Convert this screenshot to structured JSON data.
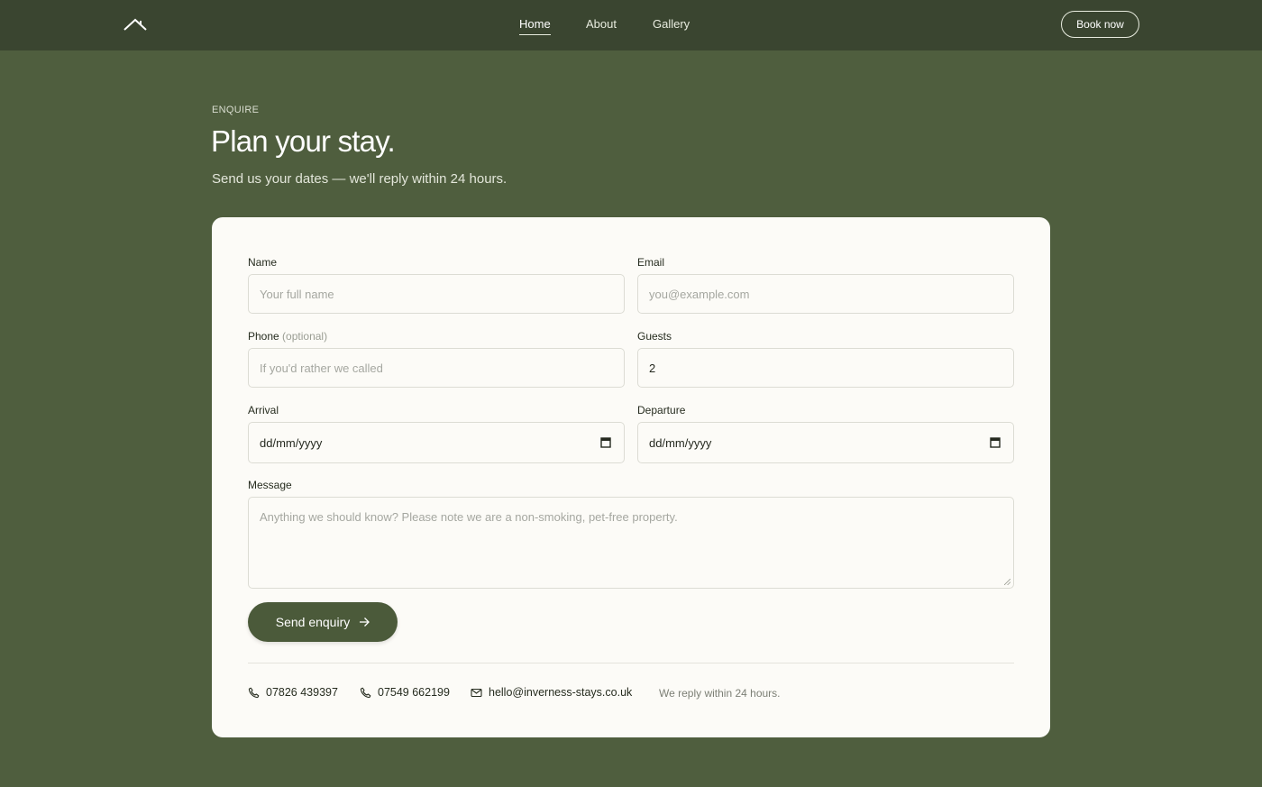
{
  "nav": {
    "logo_icon": "roof-house-icon",
    "links": [
      {
        "label": "Home",
        "active": true
      },
      {
        "label": "About",
        "active": false
      },
      {
        "label": "Gallery",
        "active": false
      }
    ],
    "cta": "Book now"
  },
  "hero": {
    "eyebrow": "ENQUIRE",
    "title": "Plan your stay.",
    "subtitle": "Send us your dates — we'll reply within 24 hours."
  },
  "form": {
    "name": {
      "label": "Name",
      "placeholder": "Your full name"
    },
    "email": {
      "label": "Email",
      "placeholder": "you@example.com"
    },
    "phone": {
      "label": "Phone",
      "optional": "(optional)",
      "placeholder": "If you'd rather we called"
    },
    "guests": {
      "label": "Guests",
      "value": "2"
    },
    "arrival": {
      "label": "Arrival",
      "value": "dd/mm/yyyy",
      "icon": "calendar-icon"
    },
    "departure": {
      "label": "Departure",
      "value": "dd/mm/yyyy",
      "icon": "calendar-icon"
    },
    "message": {
      "label": "Message",
      "placeholder": "Anything we should know? Please note we are a non-smoking, pet-free property."
    },
    "submit": "Send enquiry",
    "submit_icon": "arrow-right-icon"
  },
  "contact": {
    "phone1": "07826 439397",
    "phone2": "07549 662199",
    "email": "hello@inverness-stays.co.uk",
    "note": "We reply within 24 hours."
  },
  "colors": {
    "page_bg": "#4f5e3e",
    "header_bg": "#3a4530",
    "card_bg": "#fcfbf7",
    "button_bg": "#4b5a3a"
  }
}
